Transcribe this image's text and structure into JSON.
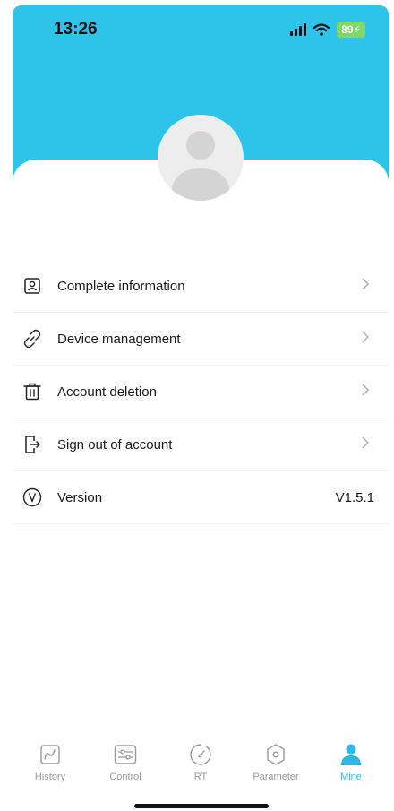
{
  "status": {
    "time": "13:26",
    "battery": "89"
  },
  "colors": {
    "header": "#2ec4ea",
    "accent": "#2eb8e6",
    "inactive": "#9a9a9a"
  },
  "avatar": {
    "icon": "user-avatar-icon"
  },
  "menu": {
    "items": [
      {
        "label": "Complete information",
        "icon": "user-card-icon"
      },
      {
        "label": "Device management",
        "icon": "broken-link-icon"
      },
      {
        "label": "Account deletion",
        "icon": "trash-icon"
      },
      {
        "label": "Sign out of account",
        "icon": "sign-out-icon"
      },
      {
        "label": "Version",
        "icon": "version-v-icon",
        "value": "V1.5.1"
      }
    ]
  },
  "tabs": [
    {
      "label": "History",
      "icon": "chart-line-icon",
      "active": false
    },
    {
      "label": "Control",
      "icon": "sliders-icon",
      "active": false
    },
    {
      "label": "RT",
      "icon": "gauge-icon",
      "active": false
    },
    {
      "label": "Parameter",
      "icon": "hexagon-settings-icon",
      "active": false
    },
    {
      "label": "Mine",
      "icon": "person-icon",
      "active": true
    }
  ]
}
